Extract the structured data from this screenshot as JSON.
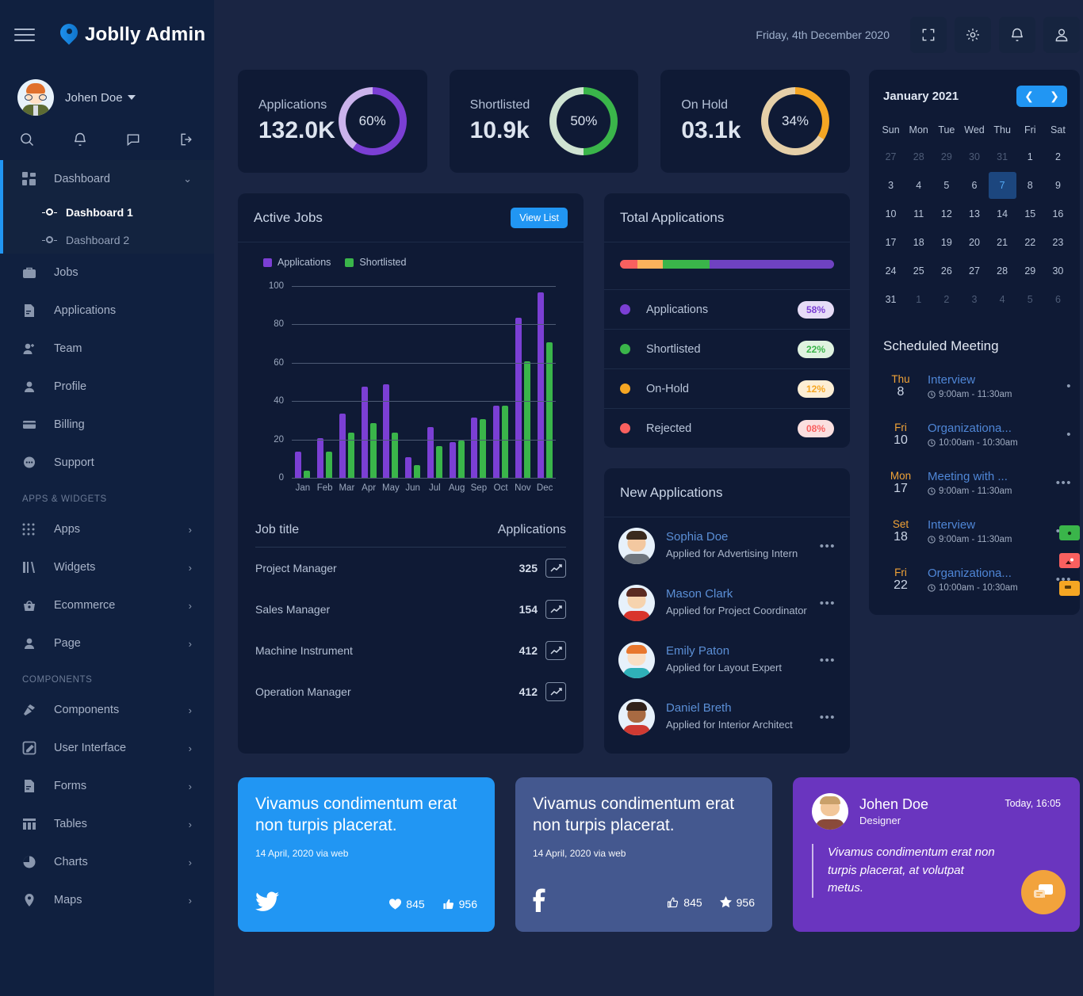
{
  "brand": {
    "name": "Joblly Admin",
    "logo_icon": "location-pin-icon"
  },
  "user": {
    "name": "Johen Doe"
  },
  "sidebar": {
    "quick_icons": [
      "search-icon",
      "bell-icon",
      "chat-icon",
      "logout-icon"
    ],
    "dashboard_group": {
      "label": "Dashboard",
      "icon": "grid-icon",
      "chevron": "chevron-down-icon"
    },
    "dashboard_children": [
      {
        "label": "Dashboard 1",
        "active": true
      },
      {
        "label": "Dashboard 2",
        "active": false
      }
    ],
    "main_items": [
      {
        "label": "Jobs",
        "icon": "briefcase-icon"
      },
      {
        "label": "Applications",
        "icon": "document-icon"
      },
      {
        "label": "Team",
        "icon": "user-plus-icon"
      },
      {
        "label": "Profile",
        "icon": "user-icon"
      },
      {
        "label": "Billing",
        "icon": "credit-card-icon"
      },
      {
        "label": "Support",
        "icon": "chat-bubble-icon"
      }
    ],
    "section_apps_title": "APPS & WIDGETS",
    "apps_items": [
      {
        "label": "Apps",
        "icon": "apps-grid-icon",
        "arrow": "chevron-right-icon"
      },
      {
        "label": "Widgets",
        "icon": "widgets-icon",
        "arrow": "chevron-right-icon"
      },
      {
        "label": "Ecommerce",
        "icon": "basket-icon",
        "arrow": "chevron-right-icon"
      },
      {
        "label": "Page",
        "icon": "user-icon",
        "arrow": "chevron-right-icon"
      }
    ],
    "section_components_title": "COMPONENTS",
    "components_items": [
      {
        "label": "Components",
        "icon": "hammer-icon",
        "arrow": "chevron-right-icon"
      },
      {
        "label": "User Interface",
        "icon": "pencil-square-icon",
        "arrow": "chevron-right-icon"
      },
      {
        "label": "Forms",
        "icon": "form-icon",
        "arrow": "chevron-right-icon"
      },
      {
        "label": "Tables",
        "icon": "table-icon",
        "arrow": "chevron-right-icon"
      },
      {
        "label": "Charts",
        "icon": "pie-chart-icon",
        "arrow": "chevron-right-icon"
      },
      {
        "label": "Maps",
        "icon": "map-pin-icon",
        "arrow": "chevron-right-icon"
      }
    ]
  },
  "topbar": {
    "date": "Friday, 4th December 2020",
    "buttons": [
      "fullscreen-icon",
      "gear-icon",
      "bell-icon",
      "user-icon"
    ]
  },
  "stats": [
    {
      "label": "Applications",
      "value": "132.0K",
      "percent": "60%",
      "percent_num": 60,
      "color": "#7b3fd4",
      "track": "#cbb3ec"
    },
    {
      "label": "Shortlisted",
      "value": "10.9k",
      "percent": "50%",
      "percent_num": 50,
      "color": "#3ab54a",
      "track": "#cfe3d2"
    },
    {
      "label": "On Hold",
      "value": "03.1k",
      "percent": "34%",
      "percent_num": 34,
      "color": "#f5a623",
      "track": "#e5cfa8"
    }
  ],
  "active_jobs": {
    "title": "Active Jobs",
    "view_list_label": "View List",
    "table_headers": {
      "title": "Job title",
      "applications": "Applications"
    },
    "rows": [
      {
        "title": "Project Manager",
        "applications": "325"
      },
      {
        "title": "Sales Manager",
        "applications": "154"
      },
      {
        "title": "Machine Instrument",
        "applications": "412"
      },
      {
        "title": "Operation Manager",
        "applications": "412"
      }
    ]
  },
  "chart_data": {
    "type": "bar",
    "title": "Active Jobs",
    "xlabel": "",
    "ylabel": "",
    "ylim": [
      0,
      100
    ],
    "yticks": [
      0,
      20,
      40,
      60,
      80,
      100
    ],
    "grid": true,
    "legend_position": "top-left",
    "categories": [
      "Jan",
      "Feb",
      "Mar",
      "Apr",
      "May",
      "Jun",
      "Jul",
      "Aug",
      "Sep",
      "Oct",
      "Nov",
      "Dec"
    ],
    "series": [
      {
        "name": "Applications",
        "color": "#7b3fd4",
        "values": [
          14,
          21,
          34,
          48,
          49,
          11,
          27,
          19,
          32,
          38,
          84,
          97
        ]
      },
      {
        "name": "Shortlisted",
        "color": "#3ab54a",
        "values": [
          4,
          14,
          24,
          29,
          24,
          7,
          17,
          20,
          31,
          38,
          61,
          71
        ]
      }
    ]
  },
  "total_applications": {
    "title": "Total Applications",
    "bar_segments": [
      {
        "color": "#f9605f",
        "width": 8
      },
      {
        "color": "#fbb25c",
        "width": 12
      },
      {
        "color": "#3ab54a",
        "width": 22
      },
      {
        "color": "#6f42c1",
        "width": 58
      }
    ],
    "rows": [
      {
        "label": "Applications",
        "value": "58%",
        "dot": "#7b3fd4",
        "pill_bg": "#e6dcf7",
        "pill_fg": "#7b3fd4"
      },
      {
        "label": "Shortlisted",
        "value": "22%",
        "dot": "#3ab54a",
        "pill_bg": "#dff3e0",
        "pill_fg": "#3ab54a"
      },
      {
        "label": "On-Hold",
        "value": "12%",
        "dot": "#f5a623",
        "pill_bg": "#fdeed4",
        "pill_fg": "#f5a623"
      },
      {
        "label": "Rejected",
        "value": "08%",
        "dot": "#f9605f",
        "pill_bg": "#fbdfdf",
        "pill_fg": "#f9605f"
      }
    ]
  },
  "new_applications": {
    "title": "New Applications",
    "rows": [
      {
        "name": "Sophia Doe",
        "sub": "Applied for Advertising Intern",
        "menu": "•••"
      },
      {
        "name": "Mason Clark",
        "sub": "Applied for Project Coordinator",
        "menu": "•••"
      },
      {
        "name": "Emily Paton",
        "sub": "Applied for Layout Expert",
        "menu": "•••"
      },
      {
        "name": "Daniel Breth",
        "sub": "Applied for Interior Architect",
        "menu": "•••"
      }
    ]
  },
  "calendar": {
    "month_label": "January 2021",
    "prev_icon": "chevron-left-icon",
    "next_icon": "chevron-right-icon",
    "dow": [
      "Sun",
      "Mon",
      "Tue",
      "Wed",
      "Thu",
      "Fri",
      "Sat"
    ],
    "weeks": [
      [
        {
          "d": "27",
          "m": true
        },
        {
          "d": "28",
          "m": true
        },
        {
          "d": "29",
          "m": true
        },
        {
          "d": "30",
          "m": true
        },
        {
          "d": "31",
          "m": true
        },
        {
          "d": "1",
          "m": false
        },
        {
          "d": "2",
          "m": false
        }
      ],
      [
        {
          "d": "3",
          "m": false
        },
        {
          "d": "4",
          "m": false
        },
        {
          "d": "5",
          "m": false
        },
        {
          "d": "6",
          "m": false
        },
        {
          "d": "7",
          "m": false,
          "sel": true
        },
        {
          "d": "8",
          "m": false
        },
        {
          "d": "9",
          "m": false
        }
      ],
      [
        {
          "d": "10",
          "m": false
        },
        {
          "d": "11",
          "m": false
        },
        {
          "d": "12",
          "m": false
        },
        {
          "d": "13",
          "m": false
        },
        {
          "d": "14",
          "m": false
        },
        {
          "d": "15",
          "m": false
        },
        {
          "d": "16",
          "m": false
        }
      ],
      [
        {
          "d": "17",
          "m": false
        },
        {
          "d": "18",
          "m": false
        },
        {
          "d": "19",
          "m": false
        },
        {
          "d": "20",
          "m": false
        },
        {
          "d": "21",
          "m": false
        },
        {
          "d": "22",
          "m": false
        },
        {
          "d": "23",
          "m": false
        }
      ],
      [
        {
          "d": "24",
          "m": false
        },
        {
          "d": "25",
          "m": false
        },
        {
          "d": "26",
          "m": false
        },
        {
          "d": "27",
          "m": false
        },
        {
          "d": "28",
          "m": false
        },
        {
          "d": "29",
          "m": false
        },
        {
          "d": "30",
          "m": false
        }
      ],
      [
        {
          "d": "31",
          "m": false
        },
        {
          "d": "1",
          "m": true
        },
        {
          "d": "2",
          "m": true
        },
        {
          "d": "3",
          "m": true
        },
        {
          "d": "4",
          "m": true
        },
        {
          "d": "5",
          "m": true
        },
        {
          "d": "6",
          "m": true
        }
      ]
    ]
  },
  "scheduled_meeting": {
    "title": "Scheduled Meeting",
    "rows": [
      {
        "dow": "Thu",
        "day": "8",
        "name": "Interview",
        "time": "9:00am - 11:30am",
        "menu": "•"
      },
      {
        "dow": "Fri",
        "day": "10",
        "name": "Organizationa...",
        "time": "10:00am - 10:30am",
        "menu": "•"
      },
      {
        "dow": "Mon",
        "day": "17",
        "name": "Meeting with ...",
        "time": "9:00am - 11:30am",
        "menu": "•••"
      },
      {
        "dow": "Set",
        "day": "18",
        "name": "Interview",
        "time": "9:00am - 11:30am",
        "menu": "•••"
      },
      {
        "dow": "Fri",
        "day": "22",
        "name": "Organizationa...",
        "time": "10:00am - 10:30am",
        "menu": "•••"
      }
    ],
    "float_icons": [
      {
        "name": "money-icon",
        "color": "#3ab54a"
      },
      {
        "name": "image-icon",
        "color": "#f9605f"
      },
      {
        "name": "note-icon",
        "color": "#f5a623"
      }
    ]
  },
  "social_cards": [
    {
      "network": "twitter",
      "icon": "twitter-icon",
      "bg": "#2196f3",
      "text": "Vivamus condimentum erat non turpis placerat.",
      "meta": "14 April, 2020 via web",
      "stat1_icon": "heart-icon",
      "stat1": "845",
      "stat2_icon": "thumbs-up-icon",
      "stat2": "956"
    },
    {
      "network": "facebook",
      "icon": "facebook-icon",
      "bg": "#44588f",
      "text": "Vivamus condimentum erat non turpis placerat.",
      "meta": "14 April, 2020 via web",
      "stat1_icon": "thumbs-up-icon",
      "stat1": "845",
      "stat2_icon": "star-icon",
      "stat2": "956"
    }
  ],
  "testimonial": {
    "name": "Johen Doe",
    "role": "Designer",
    "time": "Today, 16:05",
    "quote": "Vivamus condimentum erat non turpis placerat, at volutpat metus.",
    "fab_icon": "chat-icon"
  }
}
